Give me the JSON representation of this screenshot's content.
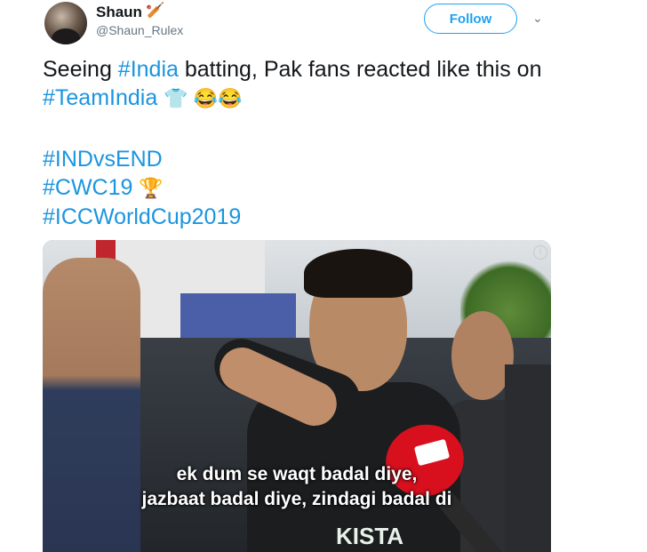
{
  "tweet": {
    "author_name": "Shaun",
    "author_handle": "@Shaun_Rulex",
    "follow_label": "Follow",
    "text_part1": "Seeing ",
    "tag_india": "#India",
    "text_part2": " batting, Pak fans reacted like this on ",
    "tag_teamindia": "#TeamIndia",
    "emojis": "👕 😂😂",
    "hashtags": [
      "#INDvsEND",
      "#CWC19",
      "#ICCWorldCup2019"
    ],
    "trophy_emoji": "🏆"
  },
  "media": {
    "subtitle_line1": "ek dum se waqt badal diye,",
    "subtitle_line2": "jazbaat badal diye, zindagi badal di",
    "shirt_text": "KISTA",
    "info_icon": "i"
  },
  "icons": {
    "name_badge": "cricket-bat-icon",
    "chevron": "chevron-down-icon"
  },
  "colors": {
    "accent": "#1da1f2",
    "hashtag": "#1b95e0",
    "text": "#14171a",
    "muted": "#657786"
  }
}
